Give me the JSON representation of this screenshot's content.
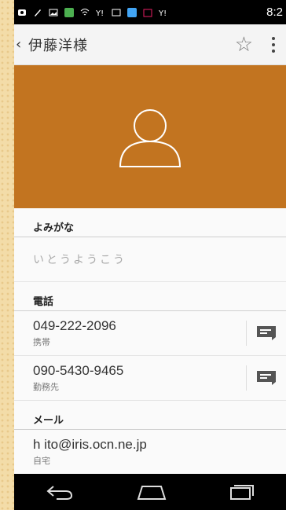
{
  "status_bar": {
    "time": "8:2"
  },
  "app_bar": {
    "back": "‹",
    "title": "伊藤洋様"
  },
  "sections": {
    "yomi": "よみがな",
    "phone": "電話",
    "mail": "メール"
  },
  "yomi_value": "いとうようこう",
  "phones": [
    {
      "number": "049-222-2096",
      "type": "携帯"
    },
    {
      "number": "090-5430-9465",
      "type": "勤務先"
    }
  ],
  "email": {
    "address": "h ito@iris.ocn.ne.jp",
    "type": "自宅"
  },
  "colors": {
    "header": "#c27420",
    "status": "#000000"
  },
  "icons": [
    "star-icon",
    "overflow-menu-icon",
    "avatar-icon",
    "message-icon",
    "back-nav-icon",
    "home-nav-icon",
    "recents-nav-icon"
  ]
}
